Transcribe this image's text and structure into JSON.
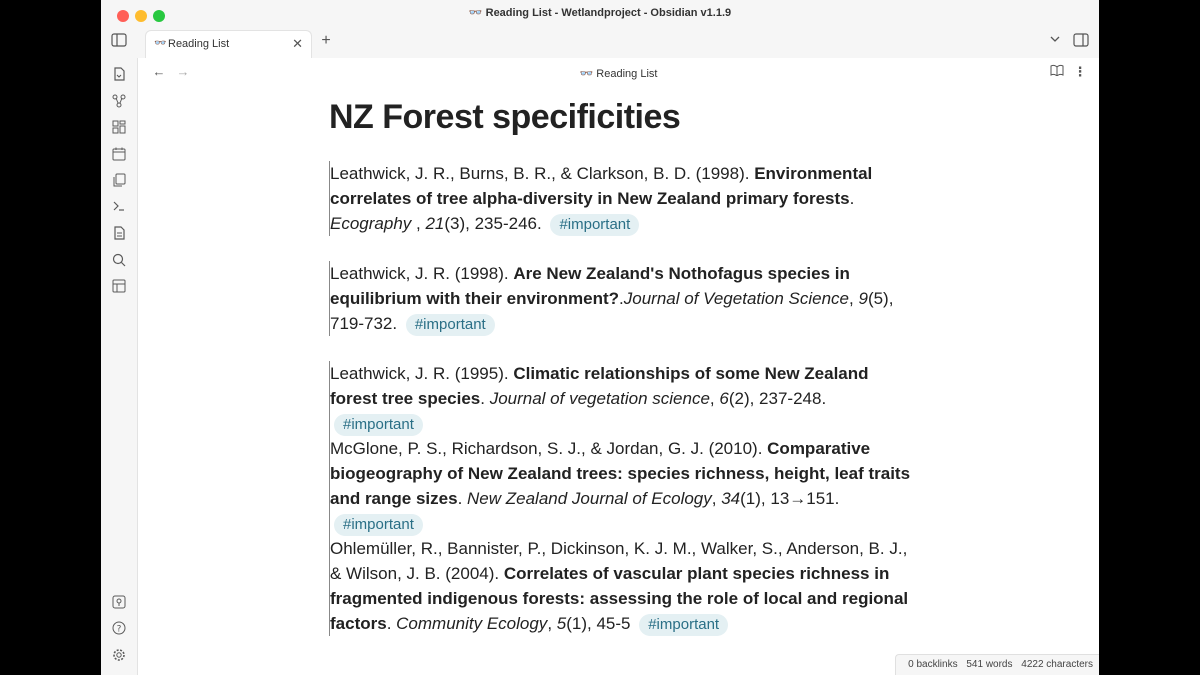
{
  "window": {
    "title": "Reading List - Wetlandproject - Obsidian v1.1.9"
  },
  "tab": {
    "label": "Reading List",
    "icon": "glasses-icon"
  },
  "view": {
    "title": "Reading List"
  },
  "note": {
    "heading": "NZ Forest specificities",
    "references": [
      {
        "authors": "Leathwick, J. R., Burns, B. R., & Clarkson, B. D. (1998). ",
        "title": "Environmental correlates of tree alpha-diversity in New Zealand primary forests",
        "sep": ". ",
        "journal": "Ecography",
        "pre_vol": " , ",
        "volume": "21",
        "rest": "(3), 235-246. ",
        "tag": "#important"
      },
      {
        "authors": "Leathwick, J. R. (1998). ",
        "title": "Are New Zealand's Nothofagus species in equilibrium with their environment?",
        "sep": ".",
        "journal": "Journal of Vegetation Science",
        "pre_vol": ", ",
        "volume": "9",
        "rest": "(5), 719-732. ",
        "tag": "#important"
      },
      {
        "authors": "Leathwick, J. R. (1995). ",
        "title": "Climatic relationships of some New Zealand forest tree species",
        "sep": ". ",
        "journal": "Journal of vegetation science",
        "pre_vol": ", ",
        "volume": "6",
        "rest": "(2), 237-248. ",
        "tag": "#important"
      },
      {
        "authors": "McGlone, P. S., Richardson, S. J., & Jordan, G. J. (2010). ",
        "title": "Comparative biogeography of New Zealand trees: species richness, height, leaf traits and range sizes",
        "sep": ". ",
        "journal": "New Zealand Journal of Ecology",
        "pre_vol": ", ",
        "volume": "34",
        "rest": "(1), 13→151. ",
        "tag": "#important"
      },
      {
        "authors": "Ohlemüller, R., Bannister, P., Dickinson, K. J. M., Walker, S., Anderson, B. J., & Wilson, J. B. (2004). ",
        "title": "Correlates of vascular plant species richness in fragmented indigenous forests: assessing the role of local and regional factors",
        "sep": ". ",
        "journal": "Community Ecology",
        "pre_vol": ", ",
        "volume": "5",
        "rest": "(1), 45-5 ",
        "tag": "#important"
      }
    ]
  },
  "status": {
    "backlinks": "0 backlinks",
    "words": "541 words",
    "characters": "4222 characters"
  },
  "colors": {
    "tag_bg": "#e4f0f3",
    "tag_text": "#2a6f86",
    "close_red": "#ff5f57",
    "minimize_yellow": "#febc2e",
    "zoom_green": "#28c840"
  }
}
